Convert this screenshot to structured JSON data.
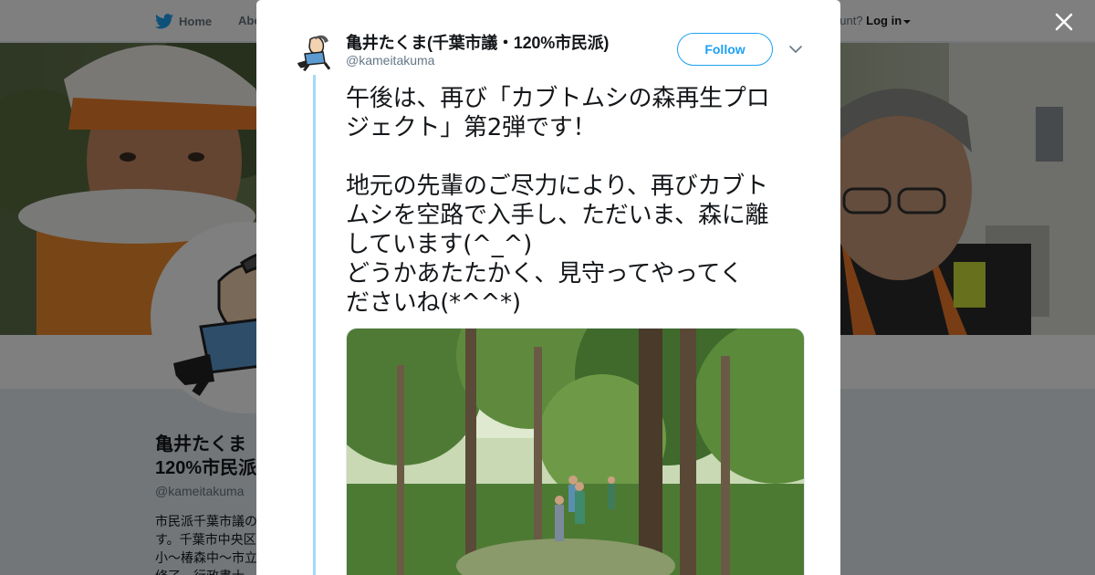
{
  "topbar": {
    "home_label": "Home",
    "about_label": "Abo",
    "account_prompt": "ccount?",
    "login_label": "Log in"
  },
  "profile": {
    "name": "亀井たくま",
    "name_line2": "120%市民派",
    "handle": "@kameitakuma",
    "bio_lines": [
      "市民派千葉市議の",
      "す。千葉市中央区",
      "小～椿森中～市立",
      "修了。行政書士"
    ]
  },
  "tweet": {
    "display_name": "亀井たくま(千葉市議・120%市民派)",
    "handle": "@kameitakuma",
    "follow_label": "Follow",
    "text_lines": [
      "午後は、再び「カブトムシの森再生プロ",
      "ジェクト」第2弾です！",
      "",
      "地元の先輩のご尽力により、再びカブト",
      "ムシを空路で入手し、ただいま、森に離",
      "しています(^_^)",
      "どうかあたたかく、見守ってやってく",
      "ださいね(*^^*)"
    ]
  },
  "colors": {
    "accent": "#1da1f2",
    "thread_line": "#a4d9f9",
    "text": "#14171a",
    "secondary": "#657786"
  }
}
